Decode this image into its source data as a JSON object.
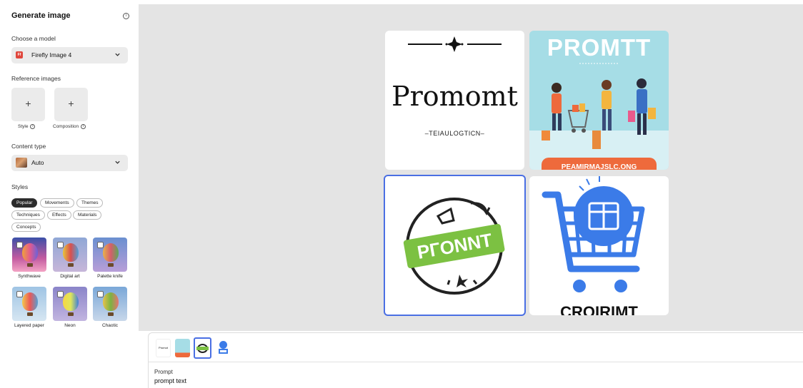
{
  "sidebar": {
    "title": "Generate image",
    "model_label": "Choose a model",
    "model_value": "Firefly Image 4",
    "model_badge": "Ff",
    "reference_label": "Reference images",
    "reference_items": [
      {
        "plus": "+",
        "caption": "Style"
      },
      {
        "plus": "+",
        "caption": "Composition"
      }
    ],
    "content_type_label": "Content type",
    "content_type_value": "Auto",
    "styles_label": "Styles",
    "style_tabs": [
      "Popular",
      "Movements",
      "Themes",
      "Techniques",
      "Effects",
      "Materials",
      "Concepts"
    ],
    "style_tiles": [
      "Synthwave",
      "Digital art",
      "Palette knife",
      "Layered paper",
      "Neon",
      "Chaotic"
    ]
  },
  "canvas": {
    "images": [
      {
        "main_text": "Promomt",
        "sub_text": "–TEIAULOGTICN–"
      },
      {
        "main_text": "PROMTT",
        "sub_text": "PEAMIRMAJSLC.ONG"
      },
      {
        "main_text": "PГONNT"
      },
      {
        "main_text": "CROIRIMT"
      }
    ]
  },
  "bottom": {
    "thumb_text": "Promot",
    "prompt_label": "Prompt",
    "prompt_value": "prompt text"
  },
  "colors": {
    "accent": "#4a6fe3",
    "canvas_bg": "#e4e4e4",
    "cart_blue": "#3b7be8",
    "stamp_green": "#7cc142",
    "banner_orange": "#ee6a3c"
  }
}
